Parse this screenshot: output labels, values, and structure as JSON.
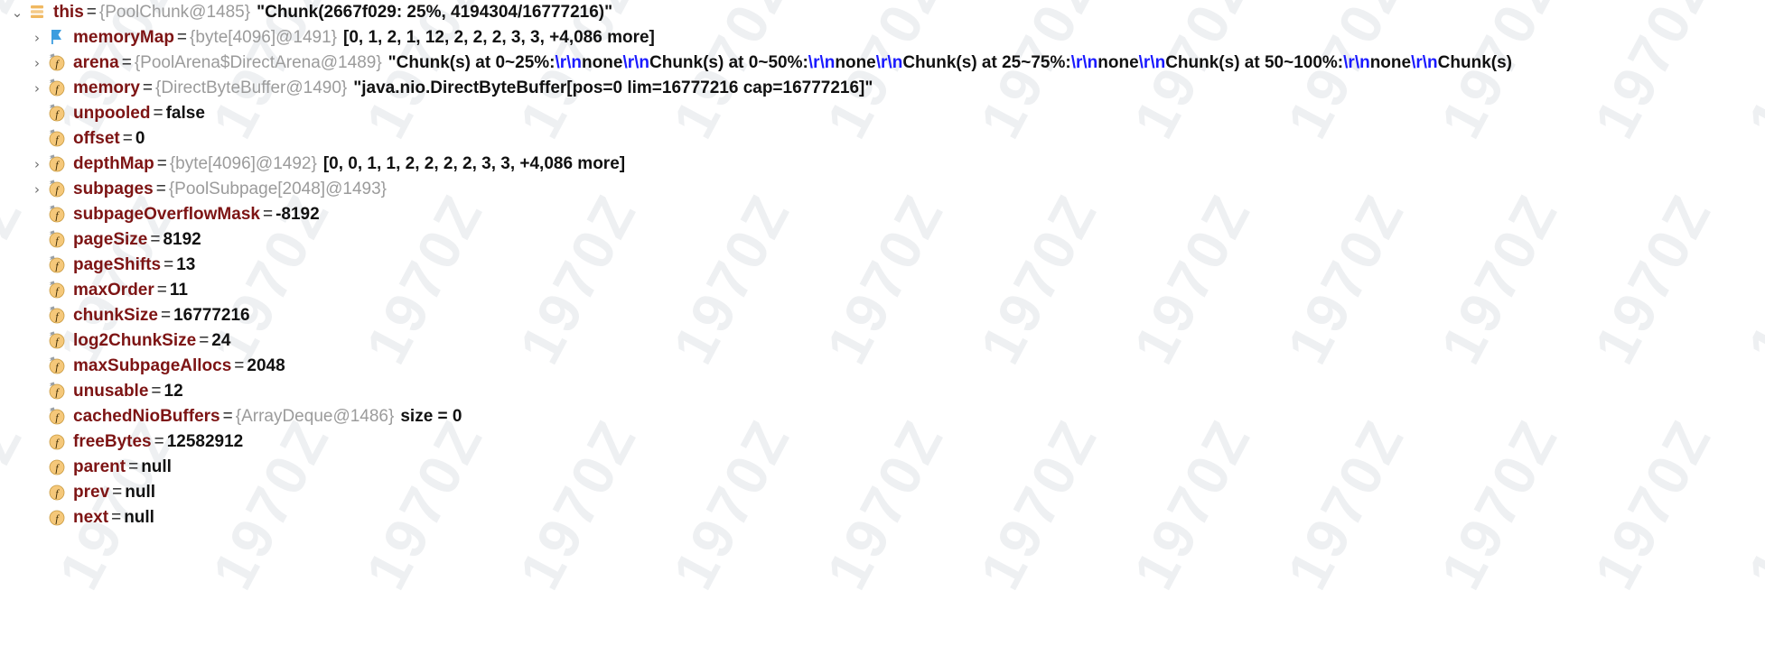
{
  "panel": {
    "name": "debugger-variables-panel",
    "app": "IntelliJ IDEA Debugger — Variables"
  },
  "colors": {
    "field_name": "#7d1414",
    "type_info": "#9b9b9b",
    "value": "#111111",
    "escape_sequence": "#1a1aff",
    "icon_field_fill": "#f5c87a",
    "icon_field_stroke": "#c99a3f",
    "icon_final_tag": "#9aa0a6",
    "icon_flag": "#3c9ddf",
    "icon_object_bars": "#f0b860",
    "background": "#ffffff"
  },
  "watermark": {
    "text": "1970Z"
  },
  "rows": [
    {
      "id": "this",
      "twisty": "expanded",
      "icon": "object-node-icon",
      "indent": 0,
      "name": "this",
      "type": "{PoolChunk@1485}",
      "value": "\"Chunk(2667f029: 25%, 4194304/16777216)\"",
      "segments": [
        {
          "kind": "type",
          "text": "{PoolChunk@1485}"
        },
        {
          "kind": "value",
          "text": "\"Chunk(2667f029: 25%, 4194304/16777216)\""
        }
      ]
    },
    {
      "id": "memoryMap",
      "twisty": "collapsed",
      "icon": "blue-flag-icon",
      "indent": 1,
      "name": "memoryMap",
      "type": "{byte[4096]@1491}",
      "value": "[0, 1, 2, 1, 12, 2, 2, 2, 3, 3, +4,086 more]",
      "segments": [
        {
          "kind": "type",
          "text": "{byte[4096]@1491}"
        },
        {
          "kind": "value",
          "text": "[0, 1, 2, 1, 12, 2, 2, 2, 3, 3, +4,086 more]"
        }
      ]
    },
    {
      "id": "arena",
      "twisty": "collapsed",
      "icon": "final-field-icon",
      "indent": 1,
      "name": "arena",
      "type": "{PoolArena$DirectArena@1489}",
      "value": "\"Chunk(s) at 0~25%:\\r\\nnone\\r\\nChunk(s) at 0~50%:\\r\\nnone\\r\\nChunk(s) at 25~75%:\\r\\nnone\\r\\nChunk(s) at 50~100%:\\r\\nnone\\r\\nChunk(s)",
      "segments": [
        {
          "kind": "type",
          "text": "{PoolArena$DirectArena@1489}"
        },
        {
          "kind": "value",
          "text": "\"Chunk(s) at 0~25%:"
        },
        {
          "kind": "esc",
          "text": "\\r\\n"
        },
        {
          "kind": "value",
          "text": "none"
        },
        {
          "kind": "esc",
          "text": "\\r\\n"
        },
        {
          "kind": "value",
          "text": "Chunk(s) at 0~50%:"
        },
        {
          "kind": "esc",
          "text": "\\r\\n"
        },
        {
          "kind": "value",
          "text": "none"
        },
        {
          "kind": "esc",
          "text": "\\r\\n"
        },
        {
          "kind": "value",
          "text": "Chunk(s) at 25~75%:"
        },
        {
          "kind": "esc",
          "text": "\\r\\n"
        },
        {
          "kind": "value",
          "text": "none"
        },
        {
          "kind": "esc",
          "text": "\\r\\n"
        },
        {
          "kind": "value",
          "text": "Chunk(s) at 50~100%:"
        },
        {
          "kind": "esc",
          "text": "\\r\\n"
        },
        {
          "kind": "value",
          "text": "none"
        },
        {
          "kind": "esc",
          "text": "\\r\\n"
        },
        {
          "kind": "value",
          "text": "Chunk(s)"
        }
      ]
    },
    {
      "id": "memory",
      "twisty": "collapsed",
      "icon": "final-field-icon",
      "indent": 1,
      "name": "memory",
      "type": "{DirectByteBuffer@1490}",
      "value": "\"java.nio.DirectByteBuffer[pos=0 lim=16777216 cap=16777216]\"",
      "segments": [
        {
          "kind": "type",
          "text": "{DirectByteBuffer@1490}"
        },
        {
          "kind": "value",
          "text": "\"java.nio.DirectByteBuffer[pos=0 lim=16777216 cap=16777216]\""
        }
      ]
    },
    {
      "id": "unpooled",
      "twisty": "none",
      "icon": "final-field-icon",
      "indent": 1,
      "name": "unpooled",
      "type": "",
      "value": "false",
      "segments": [
        {
          "kind": "value",
          "text": "false"
        }
      ]
    },
    {
      "id": "offset",
      "twisty": "none",
      "icon": "final-field-icon",
      "indent": 1,
      "name": "offset",
      "type": "",
      "value": "0",
      "segments": [
        {
          "kind": "value",
          "text": "0"
        }
      ]
    },
    {
      "id": "depthMap",
      "twisty": "collapsed",
      "icon": "final-field-icon",
      "indent": 1,
      "name": "depthMap",
      "type": "{byte[4096]@1492}",
      "value": "[0, 0, 1, 1, 2, 2, 2, 2, 3, 3, +4,086 more]",
      "segments": [
        {
          "kind": "type",
          "text": "{byte[4096]@1492}"
        },
        {
          "kind": "value",
          "text": "[0, 0, 1, 1, 2, 2, 2, 2, 3, 3, +4,086 more]"
        }
      ]
    },
    {
      "id": "subpages",
      "twisty": "collapsed",
      "icon": "final-field-icon",
      "indent": 1,
      "name": "subpages",
      "type": "{PoolSubpage[2048]@1493}",
      "value": "",
      "segments": [
        {
          "kind": "type",
          "text": "{PoolSubpage[2048]@1493}"
        }
      ]
    },
    {
      "id": "subpageOverflowMask",
      "twisty": "none",
      "icon": "final-field-icon",
      "indent": 1,
      "name": "subpageOverflowMask",
      "type": "",
      "value": "-8192",
      "segments": [
        {
          "kind": "value",
          "text": "-8192"
        }
      ]
    },
    {
      "id": "pageSize",
      "twisty": "none",
      "icon": "final-field-icon",
      "indent": 1,
      "name": "pageSize",
      "type": "",
      "value": "8192",
      "segments": [
        {
          "kind": "value",
          "text": "8192"
        }
      ]
    },
    {
      "id": "pageShifts",
      "twisty": "none",
      "icon": "final-field-icon",
      "indent": 1,
      "name": "pageShifts",
      "type": "",
      "value": "13",
      "segments": [
        {
          "kind": "value",
          "text": "13"
        }
      ]
    },
    {
      "id": "maxOrder",
      "twisty": "none",
      "icon": "final-field-icon",
      "indent": 1,
      "name": "maxOrder",
      "type": "",
      "value": "11",
      "segments": [
        {
          "kind": "value",
          "text": "11"
        }
      ]
    },
    {
      "id": "chunkSize",
      "twisty": "none",
      "icon": "final-field-icon",
      "indent": 1,
      "name": "chunkSize",
      "type": "",
      "value": "16777216",
      "segments": [
        {
          "kind": "value",
          "text": "16777216"
        }
      ]
    },
    {
      "id": "log2ChunkSize",
      "twisty": "none",
      "icon": "final-field-icon",
      "indent": 1,
      "name": "log2ChunkSize",
      "type": "",
      "value": "24",
      "segments": [
        {
          "kind": "value",
          "text": "24"
        }
      ]
    },
    {
      "id": "maxSubpageAllocs",
      "twisty": "none",
      "icon": "final-field-icon",
      "indent": 1,
      "name": "maxSubpageAllocs",
      "type": "",
      "value": "2048",
      "segments": [
        {
          "kind": "value",
          "text": "2048"
        }
      ]
    },
    {
      "id": "unusable",
      "twisty": "none",
      "icon": "final-field-icon",
      "indent": 1,
      "name": "unusable",
      "type": "",
      "value": "12",
      "segments": [
        {
          "kind": "value",
          "text": "12"
        }
      ]
    },
    {
      "id": "cachedNioBuffers",
      "twisty": "none",
      "icon": "final-field-icon",
      "indent": 1,
      "name": "cachedNioBuffers",
      "type": "{ArrayDeque@1486}",
      "value": "size = 0",
      "segments": [
        {
          "kind": "type",
          "text": "{ArrayDeque@1486}"
        },
        {
          "kind": "value",
          "text": "size = 0"
        }
      ]
    },
    {
      "id": "freeBytes",
      "twisty": "none",
      "icon": "field-icon",
      "indent": 1,
      "name": "freeBytes",
      "type": "",
      "value": "12582912",
      "segments": [
        {
          "kind": "value",
          "text": "12582912"
        }
      ]
    },
    {
      "id": "parent",
      "twisty": "none",
      "icon": "field-icon",
      "indent": 1,
      "name": "parent",
      "type": "",
      "value": "null",
      "segments": [
        {
          "kind": "value",
          "text": "null"
        }
      ]
    },
    {
      "id": "prev",
      "twisty": "none",
      "icon": "field-icon",
      "indent": 1,
      "name": "prev",
      "type": "",
      "value": "null",
      "segments": [
        {
          "kind": "value",
          "text": "null"
        }
      ]
    },
    {
      "id": "next",
      "twisty": "none",
      "icon": "field-icon",
      "indent": 1,
      "name": "next",
      "type": "",
      "value": "null",
      "segments": [
        {
          "kind": "value",
          "text": "null"
        }
      ]
    }
  ],
  "glyphs": {
    "expanded": "⌄",
    "collapsed": "›"
  }
}
